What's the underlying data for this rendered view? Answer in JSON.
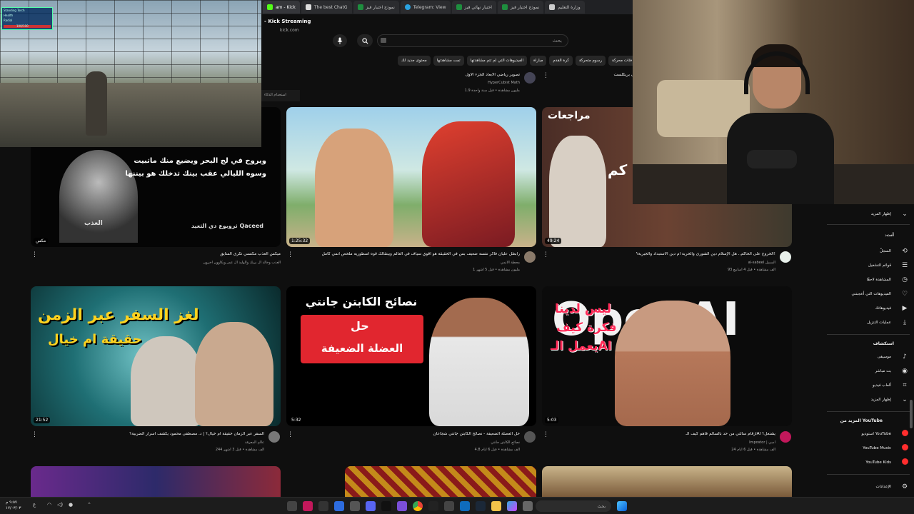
{
  "tabs": [
    {
      "label": "am - Kick",
      "color": "#53fc18",
      "active": true
    },
    {
      "label": "The best ChatG",
      "color": "#cccccc"
    },
    {
      "label": "نموذج اختبار فيز",
      "color": "#1e8e3e"
    },
    {
      "label": "Telegram: View",
      "color": "#2aa3e0"
    },
    {
      "label": "اختبار نهائي فيز",
      "color": "#1e8e3e"
    },
    {
      "label": "نموذج اختبار فيز",
      "color": "#1e8e3e"
    },
    {
      "label": "وزارة التعليم",
      "color": "#cccccc"
    }
  ],
  "kick": {
    "title": "- Kick Streaming",
    "url": "kick.com"
  },
  "search": {
    "placeholder": "بحث"
  },
  "chips": [
    "فئات محركة",
    "رسوم متحركة",
    "كرة القدم",
    "مباراة",
    "الفيديوهات التي لم تتم مشاهدتها",
    "تمت مشاهدتها",
    "محتوى جديد لك"
  ],
  "top_row": {
    "left_title": "تصوير رياضي الأبعاد الجزء الأول",
    "left_channel": "HyperCubist Math",
    "left_meta": "1.9 مليون مشاهدة • قبل سنة واحدة",
    "right_title": "ل بريكلست",
    "left_overlay_text": "استخدام الذكاء"
  },
  "game_hud": {
    "line1": "Standing Torch",
    "line2": "Health",
    "line3": "Radial",
    "bar_label": "100/100"
  },
  "videos": [
    {
      "title": "ميكس العذب مكتسي تكرى المنايق",
      "meta": "العذب وخالد ال بريك والوليد ال عمر ويكاوون آخرون",
      "duration": "مكس",
      "overlay": [
        "ويروح في لج البحر ويضيع منك ماتبيت",
        "وسوه الليالي عقب بينك تدخلك هو بيننها",
        "العذب",
        "ثروبوع دي الثعيد Qaceed"
      ]
    },
    {
      "title": "رابطل عليان فاكر نفسه ضعيف بس في الحقيقه هو اقوي سياف في العالم وبيتقالك قوه اسطوريه ملخص انمي كامل",
      "channel": "محطة الانمي",
      "meta": "1 مليون مشاهدة • قبل 5 أشهر",
      "duration": "1:25:32"
    },
    {
      "title": "الخروج على الحاكم.. هل الإسلام دين الشورى والحرية أم دين الاستبداد والجبرية؟!",
      "channel": "al-sabeel السبيل",
      "meta": "93 ألف مشاهدة • قبل 4 أسابيع",
      "duration": "49:24",
      "overlay": [
        "مراجعات",
        "كم"
      ]
    },
    {
      "title": "السفر عبر الزمان حقيقة أم خيال؟ | د. مصطفى محمود يكشف أسرار الضربية؟",
      "channel": "عالم المعرفة",
      "meta": "244 ألف مشاهدة • قبل 3 أشهر",
      "duration": "21:52",
      "overlay": [
        "لغز السفر عبر الزمن",
        "حقيقة ام خيال"
      ]
    },
    {
      "title": "حل العضلة الضعيفة - نصائح الكابتن جانتي شجاعان",
      "channel": "نصائح الكابتن جانتي",
      "meta": "4.8 ألف مشاهدة • قبل 6 أيام",
      "duration": "5:32",
      "overlay": [
        "نصائح الكابتن جانتي",
        "حل",
        "العضلة الضعيفة"
      ]
    },
    {
      "title": "أرقام سالتي من حد بالسالم فاهم كيف الـAI يشتغل؟",
      "channel": "Impostor | أمبي",
      "meta": "24 ألف مشاهدة • قبل 6 أيام",
      "duration": "5:03",
      "overlay": [
        "ليس لدينا",
        "فكرة كيف",
        "يعمل الـAI",
        "OpenAI"
      ]
    }
  ],
  "sidebar": {
    "show_more_top": "إظهار المزيد",
    "you_label": "أنت",
    "you_items": [
      {
        "label": "السجلّ",
        "icon": "history-icon",
        "glyph": "⟲"
      },
      {
        "label": "قوائم التشغيل",
        "icon": "playlist-icon",
        "glyph": "☰"
      },
      {
        "label": "المشاهدة لاحقًا",
        "icon": "clock-icon",
        "glyph": "◷"
      },
      {
        "label": "الفيديوهات التي أعجبتني",
        "icon": "like-icon",
        "glyph": "👍"
      },
      {
        "label": "فيديوهاتك",
        "icon": "your-videos-icon",
        "glyph": "▶"
      },
      {
        "label": "عمليات التنزيل",
        "icon": "download-icon",
        "glyph": "⤓"
      }
    ],
    "explore_label": "استكشاف",
    "explore_items": [
      {
        "label": "موسيقى",
        "icon": "music-icon",
        "glyph": "♪"
      },
      {
        "label": "بث مباشر",
        "icon": "live-icon",
        "glyph": "◉"
      },
      {
        "label": "ألعاب فيديو",
        "icon": "gaming-icon",
        "glyph": "⌗"
      },
      {
        "label": "إظهار المزيد",
        "icon": "chevron-down-icon",
        "glyph": "⌄"
      }
    ],
    "more_from": "المزيد من YouTube",
    "yt_items": [
      "استوديو YouTube",
      "YouTube Music",
      "YouTube Kids"
    ],
    "settings": "الإعدادات"
  },
  "taskbar": {
    "search": "بحث",
    "time": "٩:٥٧ م",
    "date": "١٧/٠٣/٠٣"
  },
  "colors": {
    "yt_red": "#ff0000",
    "kick_green": "#53fc18",
    "bg": "#0f0f0f"
  }
}
